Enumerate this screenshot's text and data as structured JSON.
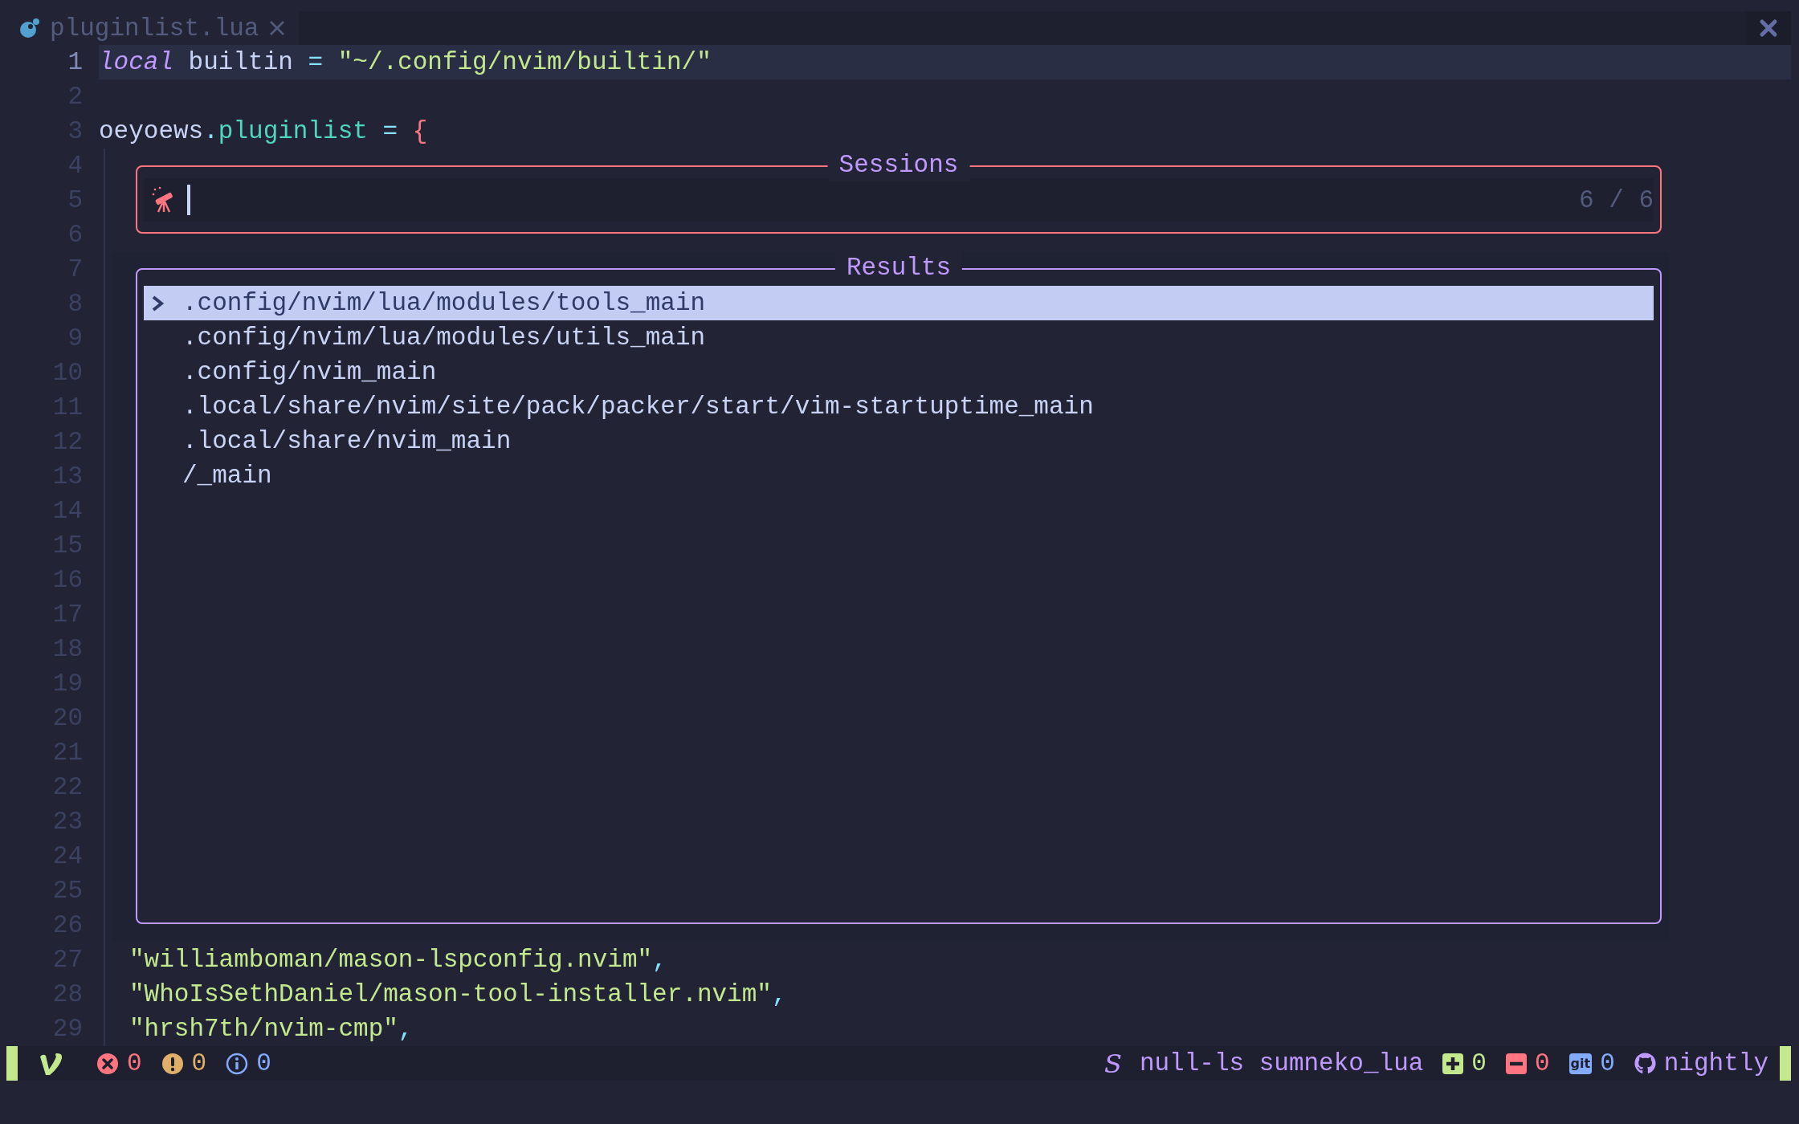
{
  "tab": {
    "filename": "pluginlist.lua",
    "selected": true
  },
  "lines": [
    {
      "number": "1",
      "current": true,
      "guide": false,
      "tokens": [
        {
          "kind": "keyword",
          "text": "local"
        },
        {
          "kind": "plain",
          "text": " builtin "
        },
        {
          "kind": "op",
          "text": "= "
        },
        {
          "kind": "string",
          "text": "\"~/.config/nvim/builtin/\""
        }
      ]
    },
    {
      "number": "2",
      "current": false,
      "guide": false
    },
    {
      "number": "3",
      "current": false,
      "guide": false,
      "tokens": [
        {
          "kind": "plain",
          "text": "oeyoews"
        },
        {
          "kind": "op",
          "text": "."
        },
        {
          "kind": "field",
          "text": "pluginlist"
        },
        {
          "kind": "op",
          "text": " = "
        },
        {
          "kind": "brace",
          "text": "{"
        }
      ]
    },
    {
      "number": "4",
      "current": false,
      "guide": true
    },
    {
      "number": "5",
      "current": false,
      "guide": true
    },
    {
      "number": "6",
      "current": false,
      "guide": true
    },
    {
      "number": "7",
      "current": false,
      "guide": true
    },
    {
      "number": "8",
      "current": false,
      "guide": true
    },
    {
      "number": "9",
      "current": false,
      "guide": true
    },
    {
      "number": "10",
      "current": false,
      "guide": true
    },
    {
      "number": "11",
      "current": false,
      "guide": true
    },
    {
      "number": "12",
      "current": false,
      "guide": true
    },
    {
      "number": "13",
      "current": false,
      "guide": true
    },
    {
      "number": "14",
      "current": false,
      "guide": true
    },
    {
      "number": "15",
      "current": false,
      "guide": true
    },
    {
      "number": "16",
      "current": false,
      "guide": true
    },
    {
      "number": "17",
      "current": false,
      "guide": true
    },
    {
      "number": "18",
      "current": false,
      "guide": true
    },
    {
      "number": "19",
      "current": false,
      "guide": true
    },
    {
      "number": "20",
      "current": false,
      "guide": true
    },
    {
      "number": "21",
      "current": false,
      "guide": true
    },
    {
      "number": "22",
      "current": false,
      "guide": true
    },
    {
      "number": "23",
      "current": false,
      "guide": true
    },
    {
      "number": "24",
      "current": false,
      "guide": true
    },
    {
      "number": "25",
      "current": false,
      "guide": true
    },
    {
      "number": "26",
      "current": false,
      "guide": true
    },
    {
      "number": "27",
      "current": false,
      "guide": true,
      "tokens": [
        {
          "kind": "string",
          "text": "\"williamboman/mason-lspconfig.nvim\""
        },
        {
          "kind": "op",
          "text": ","
        }
      ]
    },
    {
      "number": "28",
      "current": false,
      "guide": true,
      "tokens": [
        {
          "kind": "string",
          "text": "\"WhoIsSethDaniel/mason-tool-installer.nvim\""
        },
        {
          "kind": "op",
          "text": ","
        }
      ]
    },
    {
      "number": "29",
      "current": false,
      "guide": true,
      "tokens": [
        {
          "kind": "string",
          "text": "\"hrsh7th/nvim-cmp\""
        },
        {
          "kind": "op",
          "text": ","
        }
      ]
    }
  ],
  "prompt": {
    "title": "Sessions",
    "counter": "6 / 6"
  },
  "results": {
    "title": "Results",
    "items": [
      {
        "path": ".config/nvim/lua/modules/tools_main",
        "selected": true
      },
      {
        "path": ".config/nvim/lua/modules/utils_main",
        "selected": false
      },
      {
        "path": ".config/nvim_main",
        "selected": false
      },
      {
        "path": ".local/share/nvim/site/pack/packer/start/vim-startuptime_main",
        "selected": false
      },
      {
        "path": ".local/share/nvim_main",
        "selected": false
      },
      {
        "path": "/_main",
        "selected": false
      }
    ]
  },
  "status_bar": {
    "diagnostics": [
      {
        "kind": "error",
        "count": "0"
      },
      {
        "kind": "warning",
        "count": "0"
      },
      {
        "kind": "info",
        "count": "0"
      }
    ],
    "lsp_icon": "S",
    "lsp_clients": "null-ls sumneko_lua",
    "git": [
      {
        "kind": "added",
        "count": "0"
      },
      {
        "kind": "removed",
        "count": "0"
      },
      {
        "kind": "changed",
        "count": "0",
        "badge": "git"
      }
    ],
    "branch": "nightly"
  }
}
